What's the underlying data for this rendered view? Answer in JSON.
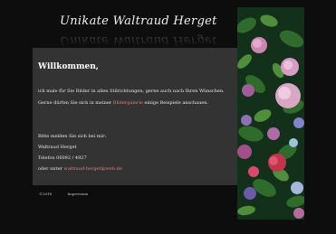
{
  "header": {
    "site_title": "Unikate Waltraud Herget"
  },
  "main": {
    "heading": "Willkommen,",
    "paragraph1": "ich male für Sie Bilder in allen Stilrichtungen, gerne auch nach Ihren Wünschen.",
    "paragraph2_before": "Gerne dürfen Sie sich in meiner",
    "paragraph2_link": "Bildergalerie",
    "paragraph2_after": "einige Beispiele anschauen.",
    "contact_intro": "Bitte melden Sie sich bei mir:",
    "contact_name": "Waltraud Herget",
    "contact_phone": "Telefon 06092 / 4927",
    "contact_email_prefix": "oder unter",
    "contact_email": "waltraud-herget@web.de"
  },
  "footer": {
    "copyright": "©2016",
    "impressum": "Impressum"
  },
  "colors": {
    "background": "#0d0d0d",
    "content_panel": "#333333",
    "link": "#e08080"
  },
  "image": {
    "flower_panel": "hydrangea-flowers-image"
  }
}
